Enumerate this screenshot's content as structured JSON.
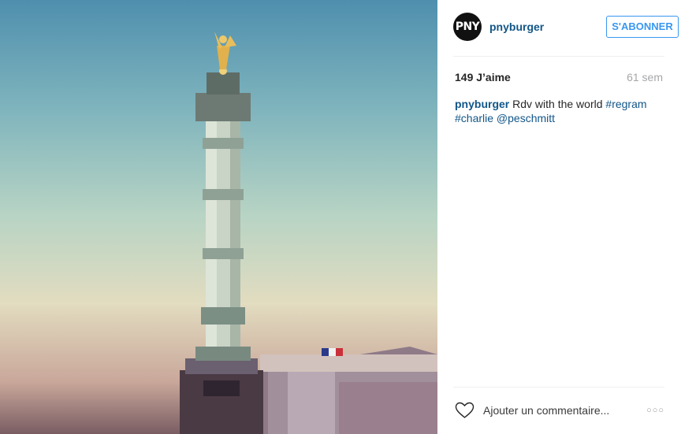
{
  "post": {
    "username": "pnyburger",
    "avatar_text": "PNY",
    "follow_label": "S'ABONNER",
    "likes": "149 J’aime",
    "age": "61 sem",
    "caption": {
      "username": "pnyburger",
      "text": " Rdv with the world ",
      "tag1": "#regram",
      "tag2": "#charlie",
      "mention": "@peschmitt"
    },
    "comment_placeholder": "Ajouter un commentaire...",
    "more_label": "○○○"
  },
  "photo": {
    "subject": "July Column monument at Place de la Bastille"
  }
}
